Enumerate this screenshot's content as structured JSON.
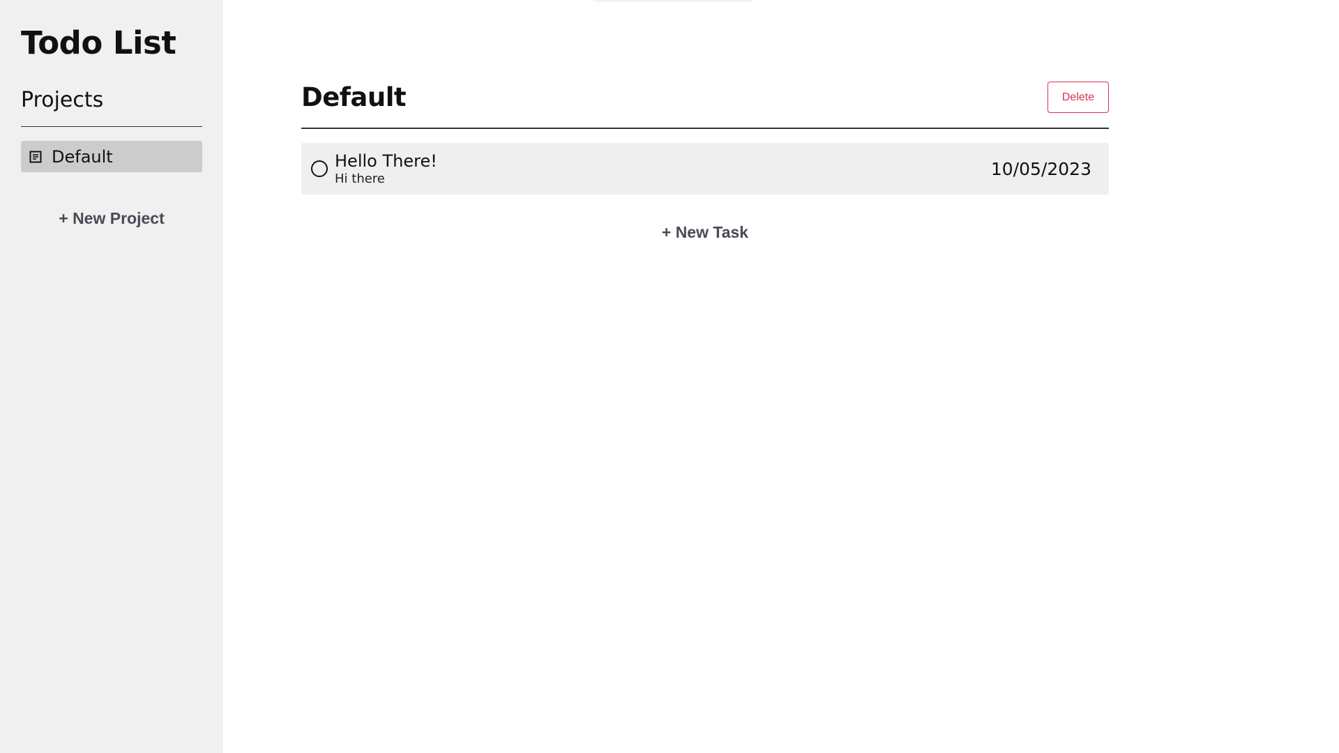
{
  "sidebar": {
    "app_title": "Todo List",
    "projects_heading": "Projects",
    "projects": [
      {
        "label": "Default",
        "icon": "list-icon",
        "selected": true
      }
    ],
    "new_project_label": "+ New Project"
  },
  "main": {
    "project_title": "Default",
    "delete_label": "Delete",
    "tasks": [
      {
        "title": "Hello There!",
        "description": "Hi there",
        "date": "10/05/2023",
        "completed": false
      }
    ],
    "new_task_label": "+ New Task"
  },
  "colors": {
    "sidebar_bg": "#f0f0f0",
    "selected_project_bg": "#cccccc",
    "task_bg": "#efefef",
    "delete_accent": "#d6334f",
    "action_text": "#4a4a55"
  }
}
